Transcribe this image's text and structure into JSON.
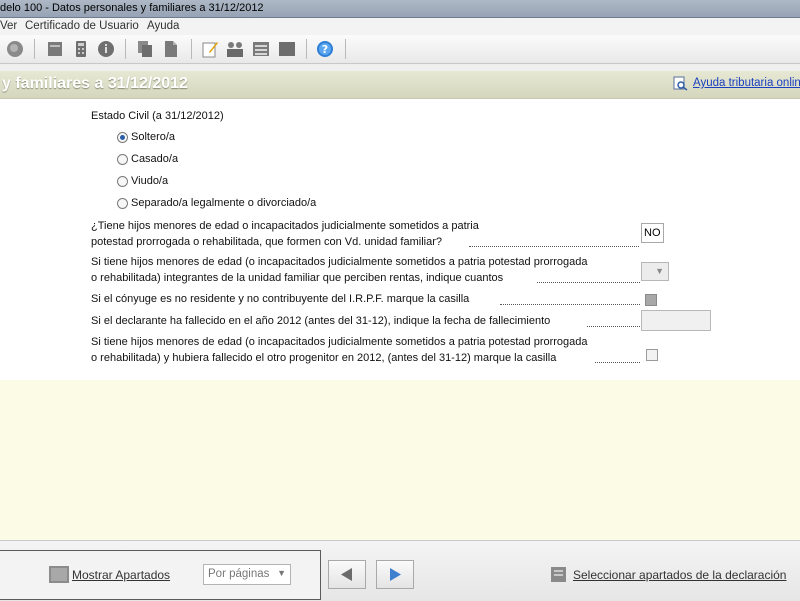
{
  "window": {
    "title": "delo 100 - Datos personales y familiares a 31/12/2012"
  },
  "menu": {
    "items": [
      "Ver",
      "Certificado de Usuario",
      "Ayuda"
    ]
  },
  "toolbar": {
    "icons": [
      "search-icon",
      "document-icon",
      "calculator-icon",
      "info-icon",
      "copy-icon",
      "paste-icon",
      "edit-icon",
      "people-icon",
      "list-icon",
      "screen-icon",
      "help-icon"
    ]
  },
  "header": {
    "title": "y familiares a 31/12/2012",
    "help_link": "Ayuda tributaria onlin"
  },
  "form": {
    "estado_civil_label": "Estado Civil (a 31/12/2012)",
    "options": [
      {
        "label": "Soltero/a",
        "selected": true
      },
      {
        "label": "Casado/a",
        "selected": false
      },
      {
        "label": "Viudo/a",
        "selected": false
      },
      {
        "label": "Separado/a legalmente o divorciado/a",
        "selected": false
      }
    ],
    "q1_line1": "¿Tiene hijos menores de edad o incapacitados judicialmente sometidos a patria",
    "q1_line2": "potestad prorrogada o rehabilitada, que formen con Vd. unidad familiar?",
    "q1_value": "NO",
    "q2_line1": "Si tiene hijos menores de edad (o incapacitados judicialmente sometidos a patria potestad prorrogada",
    "q2_line2": "o rehabilitada) integrantes de la unidad familiar que perciben rentas, indique cuantos",
    "q3": "Si el cónyuge es no residente y no contribuyente del I.R.P.F. marque la casilla",
    "q4": "Si el declarante ha fallecido en el año 2012 (antes del 31-12), indique la fecha de fallecimiento",
    "q5_line1": "Si tiene hijos menores de edad (o incapacitados judicialmente sometidos a patria potestad prorrogada",
    "q5_line2": "o rehabilitada) y hubiera fallecido el otro progenitor en 2012, (antes del 31-12) marque la casilla"
  },
  "bottom": {
    "show_sections": "Mostrar Apartados",
    "pager_select": "Por páginas",
    "select_sections": "Seleccionar apartados de la declaración"
  },
  "colors": {
    "header_bg": "#dcdfc6",
    "lower_bg": "#fbfbe6",
    "link": "#1a3fbf"
  }
}
